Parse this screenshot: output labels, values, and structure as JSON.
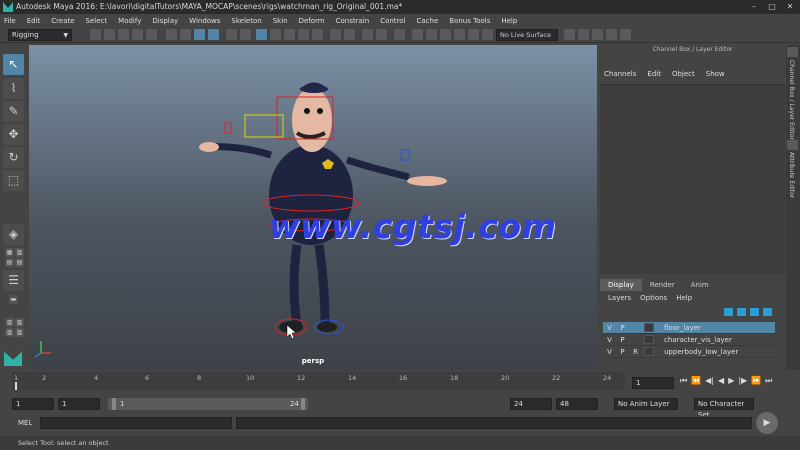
{
  "window": {
    "title": "Autodesk Maya 2016: E:\\lavori\\digitalTutors\\MAYA_MOCAP\\scenes\\rigs\\watchman_rig_Original_001.ma*",
    "minimize": "–",
    "maximize": "□",
    "close": "✕"
  },
  "menu": [
    "File",
    "Edit",
    "Create",
    "Select",
    "Modify",
    "Display",
    "Windows",
    "Skeleton",
    "Skin",
    "Deform",
    "Constrain",
    "Control",
    "Cache",
    "Bonus Tools",
    "Help"
  ],
  "shelf": {
    "mode": "Rigging",
    "live": "No Live Surface"
  },
  "viewport": {
    "camera": "persp",
    "watermark": "www.cgtsj.com"
  },
  "channel_box": {
    "title": "Channel Box / Layer Editor",
    "menu": [
      "Channels",
      "Edit",
      "Object",
      "Show"
    ]
  },
  "layer_editor": {
    "tabs": [
      "Display",
      "Render",
      "Anim"
    ],
    "active_tab": "Display",
    "menu": [
      "Layers",
      "Options",
      "Help"
    ],
    "layers": [
      {
        "v": "V",
        "p": "P",
        "r": "",
        "name": "floor_layer",
        "selected": true
      },
      {
        "v": "V",
        "p": "P",
        "r": "",
        "name": "character_vis_layer",
        "selected": false
      },
      {
        "v": "V",
        "p": "P",
        "r": "R",
        "name": "upperbody_low_layer",
        "selected": false
      }
    ]
  },
  "side_tabs": [
    "Channel Box / Layer Editor",
    "Attribute Editor"
  ],
  "timeline": {
    "ticks": [
      "2",
      "4",
      "6",
      "8",
      "10",
      "12",
      "14",
      "16",
      "18",
      "20",
      "22",
      "24"
    ],
    "start_marker": "1",
    "current_frame": "1"
  },
  "range": {
    "start": "1",
    "start2": "1",
    "bar_start": "1",
    "bar_end": "24",
    "end": "24",
    "end2": "48",
    "anim_layer": "No Anim Layer",
    "char_set": "No Character Set"
  },
  "command_line": {
    "label": "MEL"
  },
  "status": {
    "help": "Select Tool: select an object"
  },
  "colors": {
    "accent": "#5285a6",
    "panel": "#444444",
    "watermark": "#2f3fe0"
  }
}
